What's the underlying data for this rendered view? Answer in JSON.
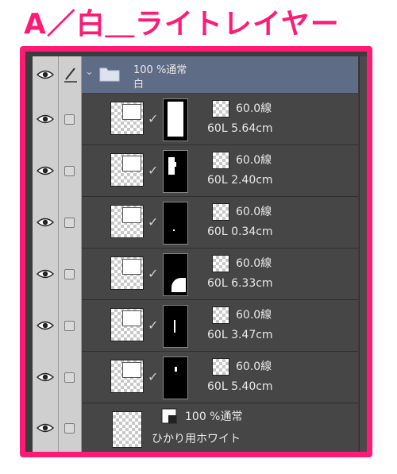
{
  "title": "A／白＿ライトレイヤー",
  "folder": {
    "opacity_blend": "100 %通常",
    "name": "白"
  },
  "layers": [
    {
      "setting": "60.0線",
      "info": "60L 5.64cm"
    },
    {
      "setting": "60.0線",
      "info": "60L 2.40cm"
    },
    {
      "setting": "60.0線",
      "info": "60L 0.34cm"
    },
    {
      "setting": "60.0線",
      "info": "60L 6.33cm"
    },
    {
      "setting": "60.0線",
      "info": "60L 3.47cm"
    },
    {
      "setting": "60.0線",
      "info": "60L 5.40cm"
    }
  ],
  "base_layer": {
    "opacity_blend": "100 %通常",
    "name": "ひかり用ホワイト"
  },
  "colors": {
    "frame": "#ff1a75",
    "folder_row": "#5f6c85",
    "panel": "#3c3c3c"
  }
}
